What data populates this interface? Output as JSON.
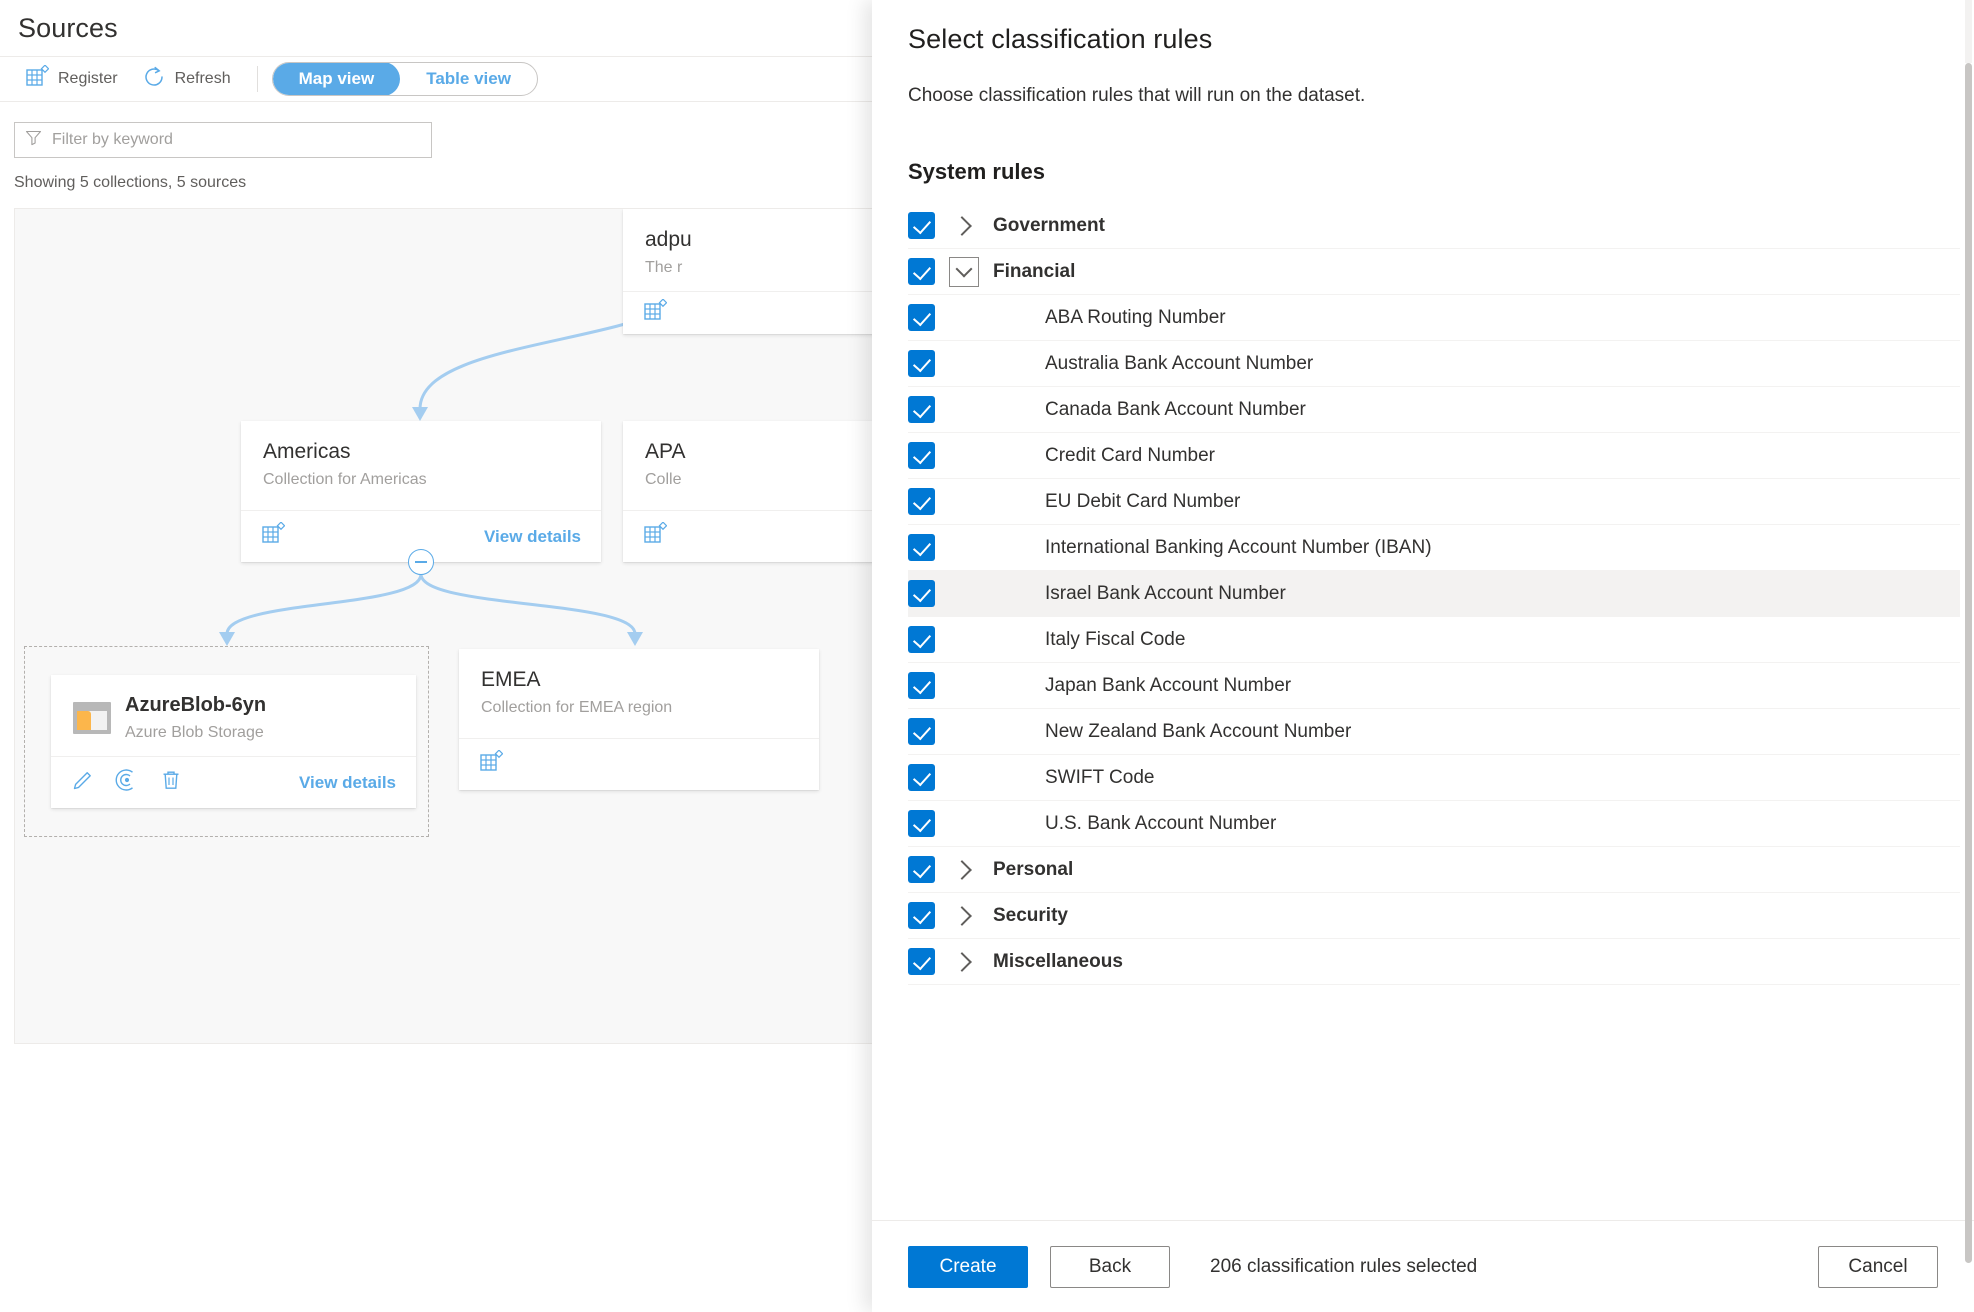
{
  "background": {
    "page_title": "Sources",
    "commands": [
      {
        "label": "Register",
        "icon": "register-grid-icon"
      },
      {
        "label": "Refresh",
        "icon": "refresh-circle-icon"
      }
    ],
    "view_toggle": {
      "options": [
        "Map view",
        "Table view"
      ],
      "selected": "Map view"
    },
    "filter": {
      "placeholder": "Filter by keyword",
      "value": "",
      "icon": "filter-funnel-icon"
    },
    "showing_text": "Showing 5 collections, 5 sources",
    "view_details_label": "View details",
    "nodes": [
      {
        "id": "adpurview",
        "title": "adpu",
        "subtitle": "The r",
        "kind": "collection",
        "icon": "collection-grid-icon"
      },
      {
        "id": "americas",
        "title": "Americas",
        "subtitle": "Collection for Americas",
        "kind": "collection",
        "icon": "collection-grid-icon"
      },
      {
        "id": "apac",
        "title": "APA",
        "subtitle": "Colle",
        "kind": "collection",
        "icon": "collection-grid-icon"
      },
      {
        "id": "emea",
        "title": "EMEA",
        "subtitle": "Collection for EMEA region",
        "kind": "collection",
        "icon": "collection-grid-icon"
      },
      {
        "id": "azureblob",
        "title": "AzureBlob-6yn",
        "subtitle": "Azure Blob Storage",
        "kind": "source",
        "icon": "azure-blob-storage-icon",
        "actions": [
          "edit-pencil-icon",
          "scan-radar-icon",
          "delete-trash-icon"
        ]
      }
    ]
  },
  "panel": {
    "title": "Select classification rules",
    "description": "Choose classification rules that will run on the dataset.",
    "section_title": "System rules",
    "rules": [
      {
        "label": "Government",
        "type": "category",
        "checked": true,
        "expanded": false,
        "level": 0
      },
      {
        "label": "Financial",
        "type": "category",
        "checked": true,
        "expanded": true,
        "level": 0
      },
      {
        "label": "ABA Routing Number",
        "type": "rule",
        "checked": true,
        "level": 1
      },
      {
        "label": "Australia Bank Account Number",
        "type": "rule",
        "checked": true,
        "level": 1
      },
      {
        "label": "Canada Bank Account Number",
        "type": "rule",
        "checked": true,
        "level": 1
      },
      {
        "label": "Credit Card Number",
        "type": "rule",
        "checked": true,
        "level": 1
      },
      {
        "label": "EU Debit Card Number",
        "type": "rule",
        "checked": true,
        "level": 1
      },
      {
        "label": "International Banking Account Number (IBAN)",
        "type": "rule",
        "checked": true,
        "level": 1
      },
      {
        "label": "Israel Bank Account Number",
        "type": "rule",
        "checked": true,
        "level": 1,
        "hovered": true
      },
      {
        "label": "Italy Fiscal Code",
        "type": "rule",
        "checked": true,
        "level": 1
      },
      {
        "label": "Japan Bank Account Number",
        "type": "rule",
        "checked": true,
        "level": 1
      },
      {
        "label": "New Zealand Bank Account Number",
        "type": "rule",
        "checked": true,
        "level": 1
      },
      {
        "label": "SWIFT Code",
        "type": "rule",
        "checked": true,
        "level": 1
      },
      {
        "label": "U.S. Bank Account Number",
        "type": "rule",
        "checked": true,
        "level": 1
      },
      {
        "label": "Personal",
        "type": "category",
        "checked": true,
        "expanded": false,
        "level": 0
      },
      {
        "label": "Security",
        "type": "category",
        "checked": true,
        "expanded": false,
        "level": 0
      },
      {
        "label": "Miscellaneous",
        "type": "category",
        "checked": true,
        "expanded": false,
        "level": 0
      }
    ],
    "footer": {
      "create_label": "Create",
      "back_label": "Back",
      "status_text": "206 classification rules selected",
      "cancel_label": "Cancel"
    }
  },
  "colors": {
    "accent": "#0078d4",
    "link": "#5aaae7",
    "text": "#323130",
    "muted": "#a19f9d",
    "row_hover": "#f3f2f1"
  }
}
